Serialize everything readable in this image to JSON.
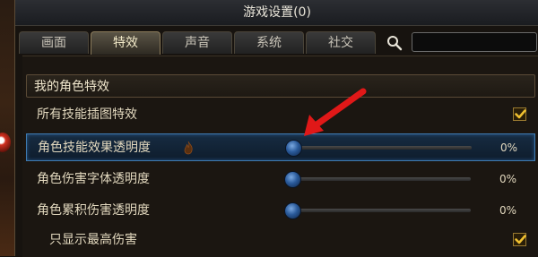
{
  "window": {
    "title": "游戏设置(0)"
  },
  "tabs": [
    {
      "label": "画面",
      "active": false
    },
    {
      "label": "特效",
      "active": true
    },
    {
      "label": "声音",
      "active": false
    },
    {
      "label": "系统",
      "active": false
    },
    {
      "label": "社交",
      "active": false
    }
  ],
  "search": {
    "value": ""
  },
  "section": {
    "title": "我的角色特效"
  },
  "rows": [
    {
      "label": "所有技能插图特效",
      "control": "checkbox",
      "checked": true
    },
    {
      "label": "角色技能效果透明度",
      "control": "slider",
      "value": 0,
      "pct": "0%",
      "highlighted": true
    },
    {
      "label": "角色伤害字体透明度",
      "control": "slider",
      "value": 0,
      "pct": "0%"
    },
    {
      "label": "角色累积伤害透明度",
      "control": "slider",
      "value": 0,
      "pct": "0%"
    },
    {
      "label": "只显示最高伤害",
      "control": "checkbox",
      "checked": true
    }
  ],
  "colors": {
    "accent_blue": "#3e7ab0",
    "checkbox_border": "#9a7a30",
    "check_mark": "#f0c030",
    "annotation_arrow": "#e01818"
  },
  "icons": [
    "search-icon",
    "flame-icon",
    "check-icon",
    "annotation-arrow"
  ]
}
